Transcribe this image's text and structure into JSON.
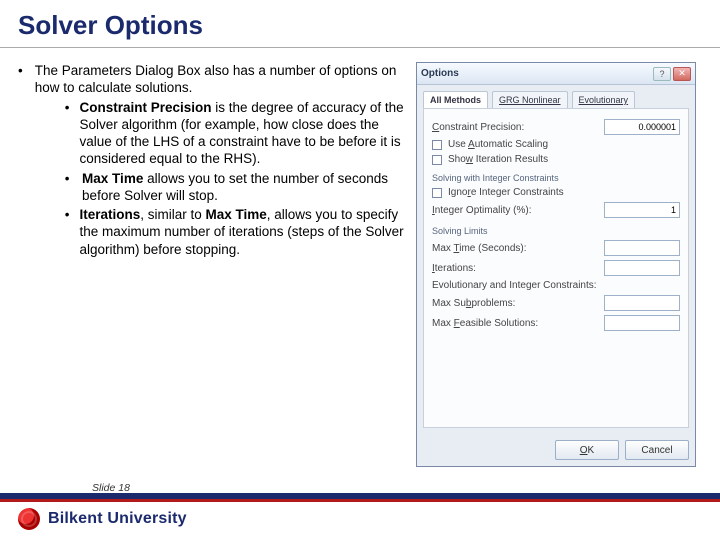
{
  "title": "Solver Options",
  "body": {
    "intro": "The Parameters Dialog Box also has a number of options on how to calculate solutions.",
    "items": [
      {
        "term": "Constraint Precision",
        "text": " is the degree of accuracy of the Solver algorithm (for example, how close does the value of the LHS of a constraint have to be before it is considered equal to the RHS)."
      },
      {
        "term": "Max Time",
        "text": " allows you to set the number of seconds before Solver will stop."
      },
      {
        "term_a": "Iterations",
        "mid": ", similar to ",
        "term_b": "Max Time",
        "text": ", allows you to specify the maximum number of iterations (steps of the Solver algorithm) before stopping."
      }
    ]
  },
  "dialog": {
    "title": "Options",
    "tabs": [
      "All Methods",
      "GRG Nonlinear",
      "Evolutionary"
    ],
    "active_tab": 0,
    "constraint_precision_label": "Constraint Precision:",
    "constraint_precision_value": "0.000001",
    "auto_scaling": "Use Automatic Scaling",
    "show_iter": "Show Iteration Results",
    "group_int": "Solving with Integer Constraints",
    "ignore_int": "Ignore Integer Constraints",
    "int_opt_label": "Integer Optimality (%):",
    "int_opt_value": "1",
    "group_limits": "Solving Limits",
    "max_time_label": "Max Time (Seconds):",
    "max_time_value": "",
    "iterations_label": "Iterations:",
    "iterations_value": "",
    "evo_header": "Evolutionary and Integer Constraints:",
    "max_subproblems_label": "Max Subproblems:",
    "max_subproblems_value": "",
    "max_feasible_label": "Max Feasible Solutions:",
    "max_feasible_value": "",
    "ok": "OK",
    "cancel": "Cancel"
  },
  "footer": {
    "slide_no": "Slide 18",
    "university": "Bilkent University"
  }
}
